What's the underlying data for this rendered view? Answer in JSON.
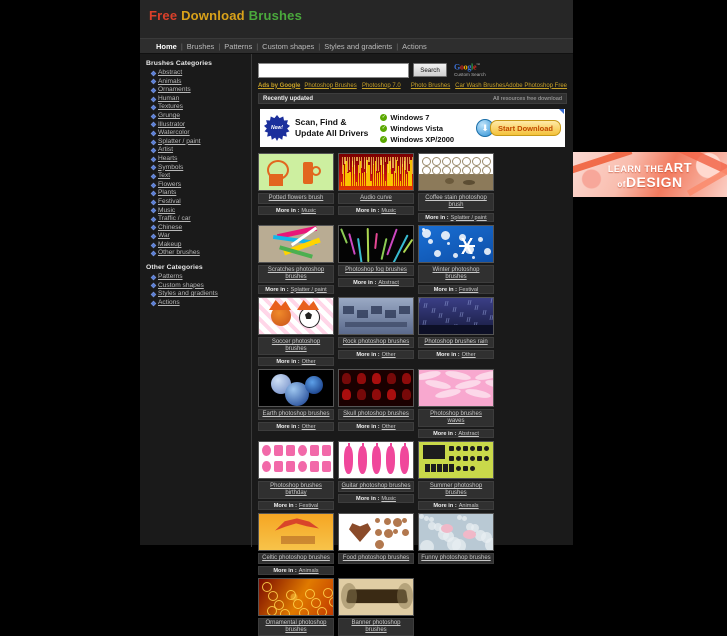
{
  "site": {
    "logo": {
      "part1": "Free",
      "part2": "Download",
      "part3": "Brushes"
    },
    "nav": [
      {
        "label": "Home",
        "active": true
      },
      {
        "label": "Brushes",
        "active": false
      },
      {
        "label": "Patterns",
        "active": false
      },
      {
        "label": "Custom shapes",
        "active": false
      },
      {
        "label": "Styles and gradients",
        "active": false
      },
      {
        "label": "Actions",
        "active": false
      }
    ]
  },
  "sidebar": {
    "heading_main": "Brushes Categories",
    "heading_other": "Other Categories",
    "items": [
      {
        "label": "Abstract"
      },
      {
        "label": "Animals"
      },
      {
        "label": "Ornaments"
      },
      {
        "label": "Human"
      },
      {
        "label": "Textures"
      },
      {
        "label": "Grunge"
      },
      {
        "label": "Illustrator"
      },
      {
        "label": "Watercolor"
      },
      {
        "label": "Splatter / paint"
      },
      {
        "label": "Artist"
      },
      {
        "label": "Hearts"
      },
      {
        "label": "Symbols"
      },
      {
        "label": "Text"
      },
      {
        "label": "Flowers"
      },
      {
        "label": "Plants"
      },
      {
        "label": "Festival"
      },
      {
        "label": "Music"
      },
      {
        "label": "Traffic / car"
      },
      {
        "label": "Chinese"
      },
      {
        "label": "War"
      },
      {
        "label": "Makeup"
      },
      {
        "label": "Other brushes"
      }
    ],
    "other_items": [
      {
        "label": "Patterns"
      },
      {
        "label": "Custom shapes"
      },
      {
        "label": "Styles and gradients"
      },
      {
        "label": "Actions"
      }
    ]
  },
  "search": {
    "value": "",
    "placeholder": "",
    "button_label": "Search",
    "google_word": "Google",
    "google_tm": "™",
    "google_sub": "Custom Search"
  },
  "ads_links": {
    "label": "Ads by Google",
    "links": [
      {
        "label": "Photoshop Brushes"
      },
      {
        "label": "Photoshop 7.0"
      },
      {
        "label": "Photo Brushes"
      },
      {
        "label": "Car Wash Brushes"
      },
      {
        "label": "Adobe Photoshop Free"
      }
    ]
  },
  "status_bar": {
    "left": "Recently updated",
    "right": "All resources free download"
  },
  "banner_ad": {
    "badge": "New!",
    "headline_line1": "Scan, Find &",
    "headline_line2": "Update All Drivers",
    "features": [
      "Windows 7",
      "Windows Vista",
      "Windows XP/2000"
    ],
    "cta": "Start Download",
    "tick_glyph": "✓",
    "arrow_glyph": "⬇"
  },
  "rail_ad": {
    "line1_small": "LEARN",
    "line1_the": "THE",
    "line1_big": "ART",
    "line2_of": "of",
    "line2_big": "DESIGN"
  },
  "grid": {
    "more_label": "More in :",
    "items": [
      {
        "title": "Potted flowers brush",
        "category": "Music",
        "art": "t-potted"
      },
      {
        "title": "Audio curve",
        "category": "Music",
        "art": "t-audio"
      },
      {
        "title": "Coffee stain photoshop brush",
        "category": "Splatter / paint",
        "art": "t-coffee"
      },
      {
        "title": "Scratches photoshop brushes",
        "category": "Splatter / paint",
        "art": "t-scratch"
      },
      {
        "title": "Photoshop fog brushes",
        "category": "Abstract",
        "art": "t-fog"
      },
      {
        "title": "Winter photoshop brushes",
        "category": "Festival",
        "art": "t-winter"
      },
      {
        "title": "Soccer photoshop brushes",
        "category": "Other",
        "art": "t-soccer"
      },
      {
        "title": "Rock photoshop brushes",
        "category": "Other",
        "art": "t-rock"
      },
      {
        "title": "Photoshop brushes rain",
        "category": "Other",
        "art": "t-rain"
      },
      {
        "title": "Earth photoshop brushes",
        "category": "Other",
        "art": "t-earth"
      },
      {
        "title": "Skull photoshop brushes",
        "category": "Other",
        "art": "t-skull"
      },
      {
        "title": "Photoshop brushes waves",
        "category": "Abstract",
        "art": "t-waves"
      },
      {
        "title": "Photoshop brushes birthday",
        "category": "Festival",
        "art": "t-birthday"
      },
      {
        "title": "Guitar photoshop brushes",
        "category": "Music",
        "art": "t-guitar"
      },
      {
        "title": "Summer photoshop brushes",
        "category": "Animals",
        "art": "t-summer"
      },
      {
        "title": "Celtic photoshop brushes",
        "category": "Animals",
        "art": "t-celtic"
      },
      {
        "title": "Food photoshop brushes",
        "category": "",
        "art": "t-food"
      },
      {
        "title": "Funny photoshop brushes",
        "category": "",
        "art": "t-funny"
      },
      {
        "title": "Ornamental photoshop brushes",
        "category": "",
        "art": "t-ornament"
      },
      {
        "title": "Banner photoshop brushes",
        "category": "",
        "art": "t-banner"
      }
    ]
  },
  "colors": {
    "page_bg": "#000000",
    "site_bg": "#1a1a1a",
    "header_bg": "#262626",
    "nav_bg": "#2e2e2e",
    "panel_bg": "#303030",
    "link": "#c8c8c8",
    "ad_link": "#c9a227",
    "logo_red": "#d9402a",
    "logo_yellow": "#d9a21a",
    "logo_green": "#4aa83c"
  }
}
